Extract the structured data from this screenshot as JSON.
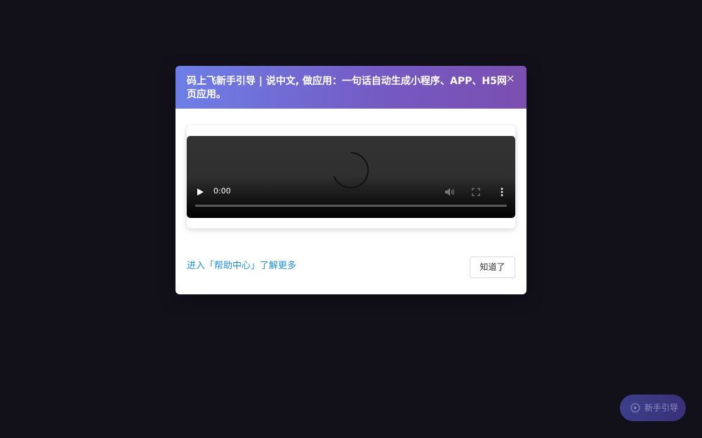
{
  "modal": {
    "title": "码上飞新手引导 | 说中文, 做应用：一句话自动生成小程序、APP、H5网页应用。",
    "close_icon": "close-icon",
    "video": {
      "current_time": "0:00",
      "state": "loading",
      "progress": 0,
      "icons": {
        "play": "play-icon",
        "volume": "volume-icon",
        "fullscreen": "fullscreen-icon",
        "more": "more-vertical-icon",
        "spinner": "loading-spinner-icon"
      }
    },
    "help_link_label": "进入「帮助中心」了解更多",
    "ok_button_label": "知道了"
  },
  "guide_button": {
    "label": "新手引导",
    "icon": "play-circle-icon"
  },
  "colors": {
    "background": "#12111a",
    "header_gradient_start": "#6d7fe6",
    "header_gradient_end": "#7a4fb0",
    "link": "#1f8fd8",
    "guide_button": "#3b3f8a"
  }
}
